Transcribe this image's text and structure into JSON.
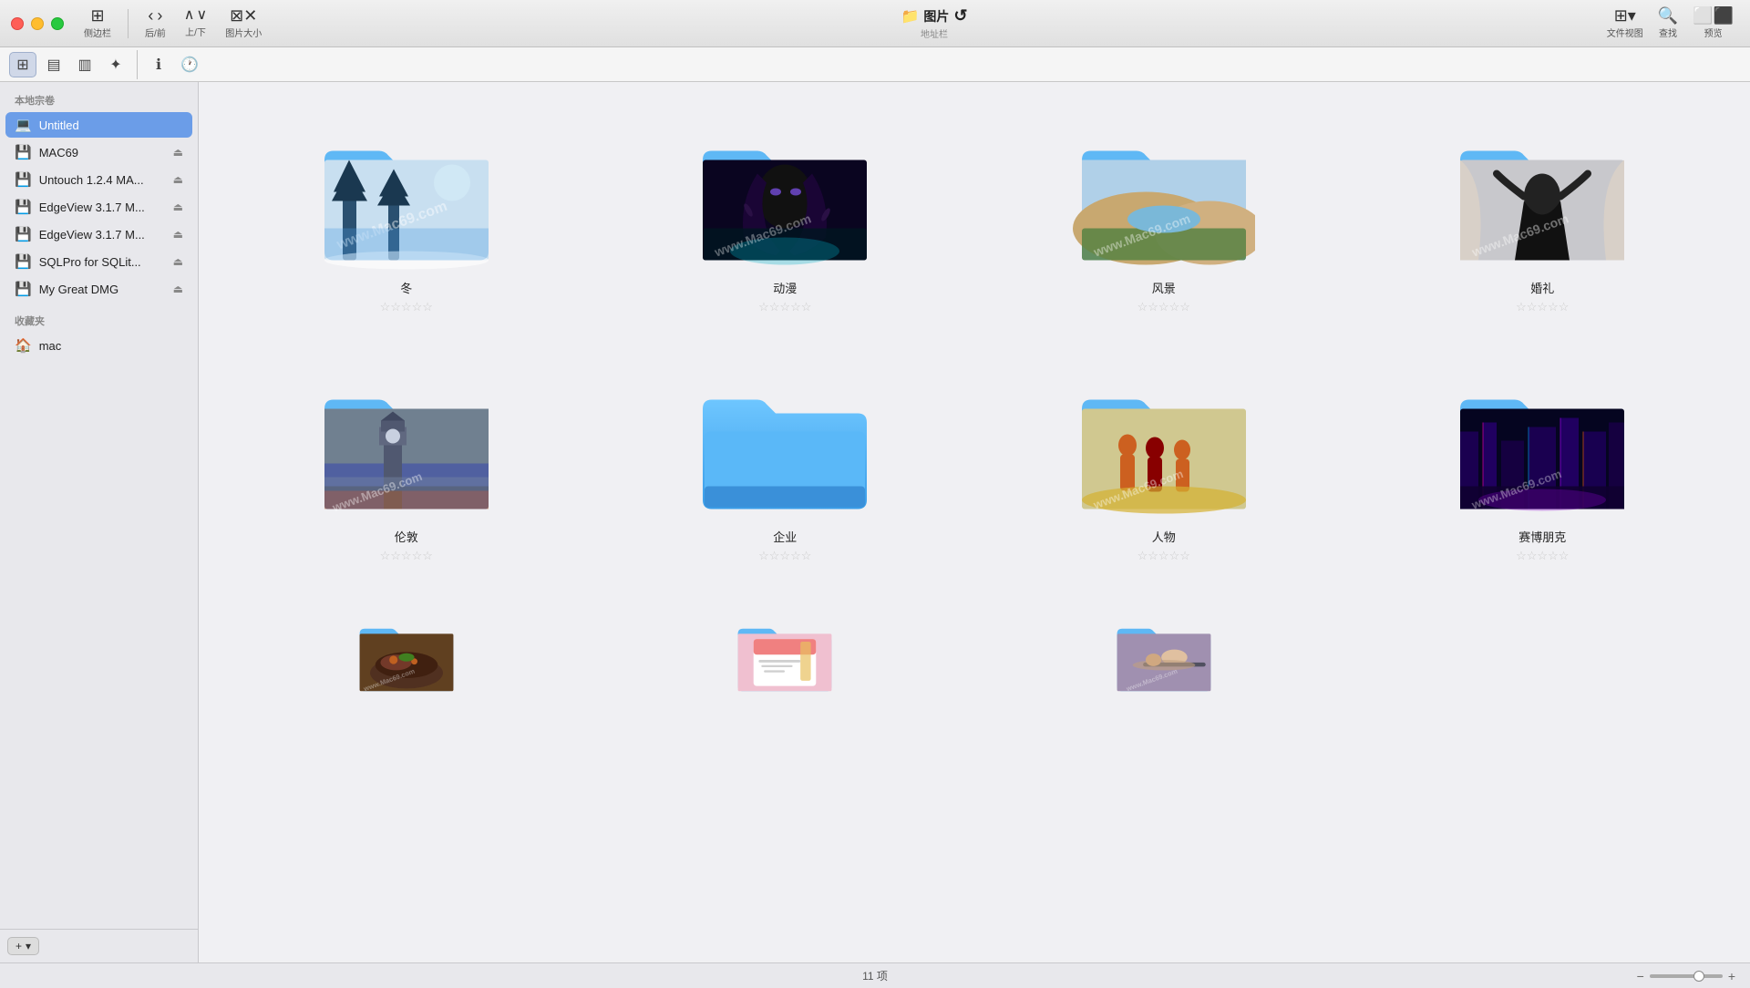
{
  "titlebar": {
    "sidebar_label": "侧边栏",
    "nav_label": "后/前",
    "sort_label": "上/下",
    "size_label": "图片大小",
    "address_title": "图片",
    "address_subtitle": "地址栏",
    "view_label": "文件视图",
    "search_label": "查找",
    "preview_label": "预览"
  },
  "toolbar": {
    "icons": [
      "icon1",
      "icon2",
      "icon3",
      "icon4",
      "icon5",
      "icon6"
    ]
  },
  "sidebar": {
    "local_section": "本地宗卷",
    "favorites_section": "收藏夹",
    "local_items": [
      {
        "id": "untitled",
        "label": "Untitled",
        "icon": "💻",
        "active": true,
        "eject": true
      },
      {
        "id": "mac69",
        "label": "MAC69",
        "icon": "💾",
        "active": false,
        "eject": true
      },
      {
        "id": "untouch",
        "label": "Untouch 1.2.4 MA...",
        "icon": "💾",
        "active": false,
        "eject": true
      },
      {
        "id": "edgeview1",
        "label": "EdgeView 3.1.7 M...",
        "icon": "💾",
        "active": false,
        "eject": true
      },
      {
        "id": "edgeview2",
        "label": "EdgeView 3.1.7 M...",
        "icon": "💾",
        "active": false,
        "eject": true
      },
      {
        "id": "sqlpro",
        "label": "SQLPro for SQLit...",
        "icon": "💾",
        "active": false,
        "eject": true
      },
      {
        "id": "greatdmg",
        "label": "My Great DMG",
        "icon": "💾",
        "active": false,
        "eject": true
      }
    ],
    "favorites_items": [
      {
        "id": "mac",
        "label": "mac",
        "icon": "🏠",
        "active": false,
        "eject": false
      }
    ],
    "add_button": "+ ▾"
  },
  "content": {
    "folders": [
      {
        "id": "winter",
        "name": "冬",
        "has_images": true,
        "color": "#4a9de0"
      },
      {
        "id": "anime",
        "name": "动漫",
        "has_images": true,
        "color": "#4a9de0"
      },
      {
        "id": "scenery",
        "name": "风景",
        "has_images": true,
        "color": "#4a9de0"
      },
      {
        "id": "wedding",
        "name": "婚礼",
        "has_images": true,
        "color": "#4a9de0"
      },
      {
        "id": "london",
        "name": "伦敦",
        "has_images": true,
        "color": "#4a9de0"
      },
      {
        "id": "enterprise",
        "name": "企业",
        "has_images": false,
        "color": "#4a9de0"
      },
      {
        "id": "people",
        "name": "人物",
        "has_images": true,
        "color": "#4a9de0"
      },
      {
        "id": "cyberpunk",
        "name": "赛博朋克",
        "has_images": true,
        "color": "#4a9de0"
      },
      {
        "id": "food",
        "name": "",
        "has_images": true,
        "color": "#4a9de0"
      },
      {
        "id": "poster",
        "name": "",
        "has_images": true,
        "color": "#4a9de0"
      },
      {
        "id": "gym",
        "name": "",
        "has_images": true,
        "color": "#4a9de0"
      }
    ],
    "stars": "★★★★★",
    "status_count": "11 项"
  },
  "colors": {
    "folder_blue": "#4a9de0",
    "folder_dark_blue": "#3a8acd",
    "folder_light_blue": "#6ab8f0",
    "sidebar_active": "#6b9de8"
  }
}
